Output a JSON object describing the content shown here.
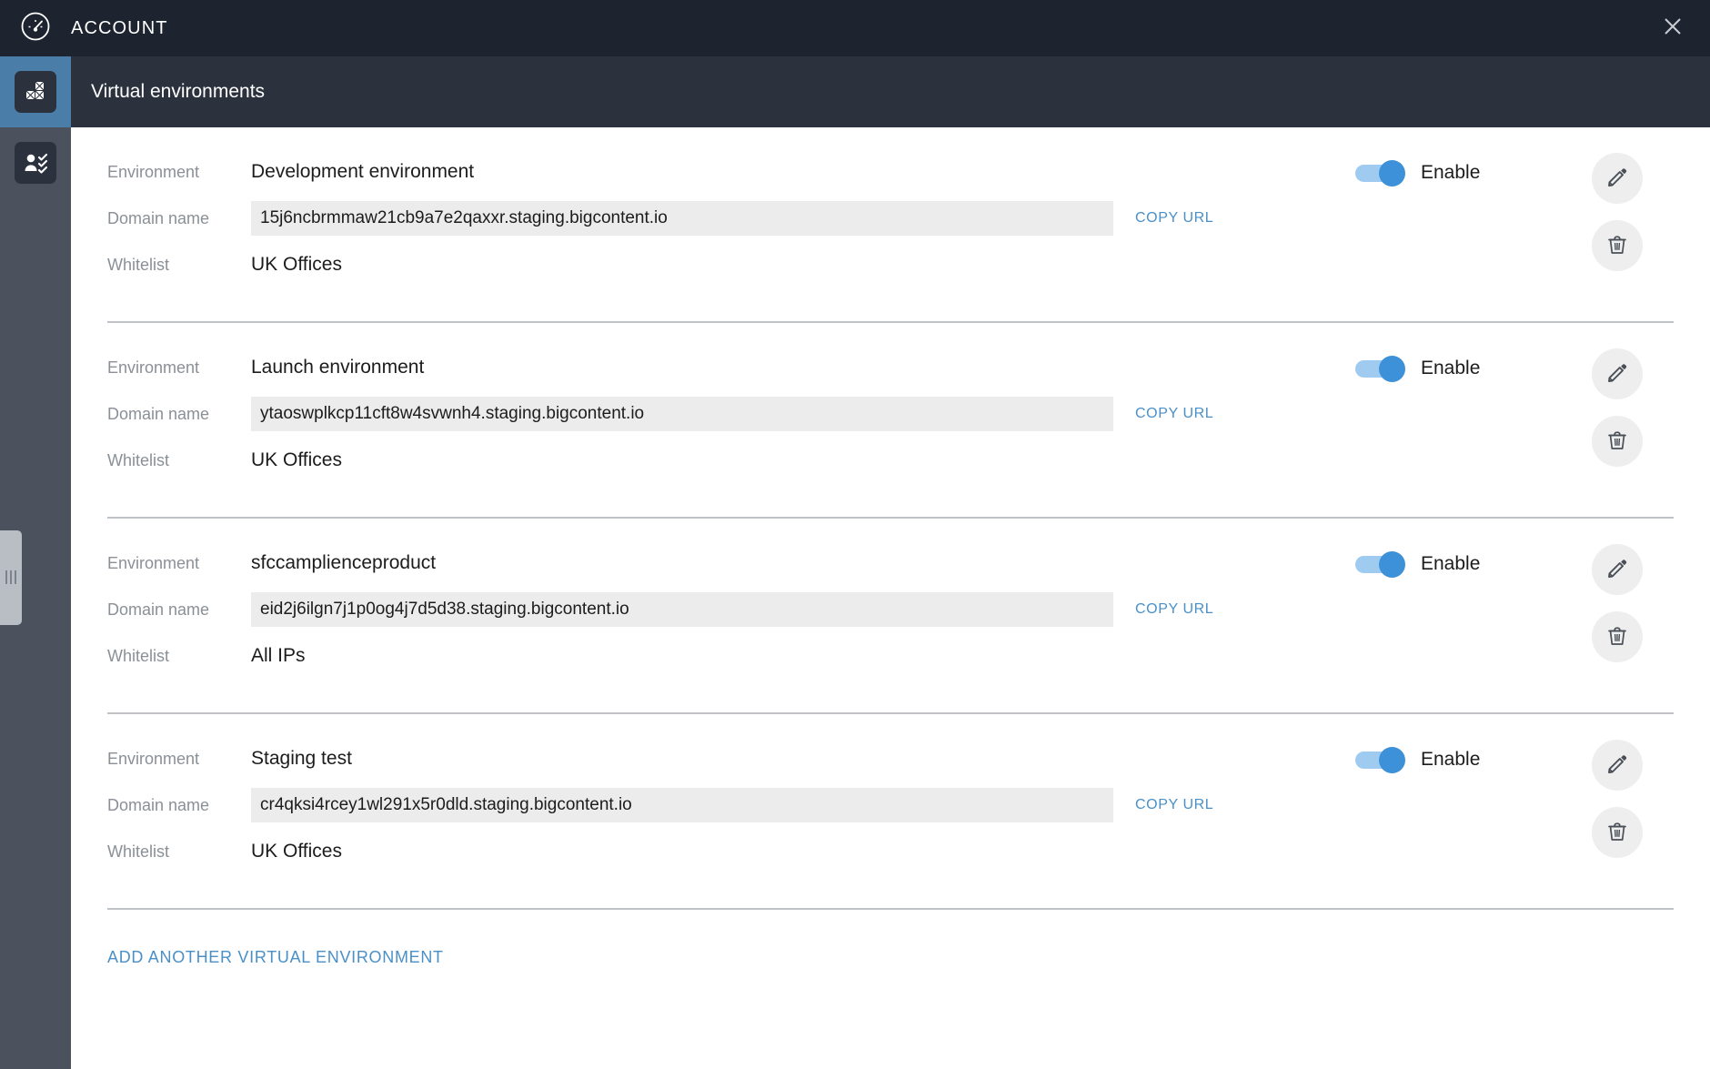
{
  "topbar": {
    "title": "ACCOUNT",
    "logo_icon": "dashboard-gauge-icon",
    "close_icon": "close-icon"
  },
  "sidebar": {
    "items": [
      {
        "icon": "virtual-environments-blocks-icon",
        "active": true
      },
      {
        "icon": "user-permissions-checklist-icon",
        "active": false
      }
    ],
    "resize_handle_icon": "drag-grip-icon"
  },
  "section": {
    "title": "Virtual environments"
  },
  "labels": {
    "environment": "Environment",
    "domain_name": "Domain name",
    "whitelist": "Whitelist",
    "copy_url": "COPY URL",
    "enable": "Enable",
    "edit_icon": "pencil-edit-icon",
    "delete_icon": "trash-delete-icon"
  },
  "colors": {
    "accent_blue": "#4a90c7",
    "toggle_on": "#3d91d8",
    "toggle_track": "#9ecbef",
    "topbar_bg": "#1d2430",
    "section_bg": "#2b323d",
    "rail_bg": "#4b525e",
    "rail_active": "#4a7ea8"
  },
  "environments": [
    {
      "name": "Development environment",
      "domain": "15j6ncbrmmaw21cb9a7e2qaxxr.staging.bigcontent.io",
      "whitelist": "UK Offices",
      "enabled": true,
      "enable_label": "Enable"
    },
    {
      "name": "Launch environment",
      "domain": "ytaoswplkcp11cft8w4svwnh4.staging.bigcontent.io",
      "whitelist": "UK Offices",
      "enabled": true,
      "enable_label": "Enable"
    },
    {
      "name": "sfccamplienceproduct",
      "domain": "eid2j6ilgn7j1p0og4j7d5d38.staging.bigcontent.io",
      "whitelist": "All IPs",
      "enabled": true,
      "enable_label": "Enable"
    },
    {
      "name": "Staging test",
      "domain": "cr4qksi4rcey1wl291x5r0dld.staging.bigcontent.io",
      "whitelist": "UK Offices",
      "enabled": true,
      "enable_label": "Enable"
    }
  ],
  "footer": {
    "add_label": "ADD ANOTHER VIRTUAL ENVIRONMENT"
  }
}
